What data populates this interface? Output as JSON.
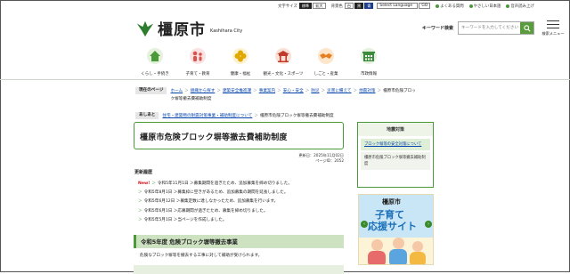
{
  "util": {
    "font_size_label": "文字サイズ",
    "font_std": "標準",
    "font_large": "拡大",
    "bg_label": "背景色",
    "bg_white": "白",
    "bg_black": "黒",
    "bg_blue": "青",
    "language": "Select Language",
    "go": "GO",
    "links": [
      "よくある質問",
      "やさしい日本語",
      "音声読み上げ"
    ]
  },
  "logo": {
    "jp": "橿原市",
    "en": "Kashihara City"
  },
  "search": {
    "label": "キーワード検索",
    "placeholder": "キーワードを入力してください"
  },
  "menu_label": "検索メニュー",
  "nav": [
    {
      "label": "くらし・手続き",
      "icon": "house-icon"
    },
    {
      "label": "子育て・教育",
      "icon": "family-icon"
    },
    {
      "label": "健康・福祉",
      "icon": "clover-icon"
    },
    {
      "label": "観光・文化・スポーツ",
      "icon": "temple-icon"
    },
    {
      "label": "しごと・産業",
      "icon": "handshake-icon"
    },
    {
      "label": "市政情報",
      "icon": "cityhall-icon"
    }
  ],
  "breadcrumb": {
    "label": "現在のページ",
    "items": [
      "ホーム",
      "組織から探す",
      "建築安全推進課",
      "事業案内",
      "安心・安全",
      "防災",
      "災害に備えて",
      "地震対策"
    ],
    "current": "橿原市危険ブロック塀等撤去費補助制度",
    "related_label": "あしあと",
    "related": "住宅・建築物の耐震対策事業・補助制度について",
    "related_current": "橿原市危険ブロック塀等撤去費補助制度"
  },
  "title": "橿原市危険ブロック塀等撤去費補助制度",
  "meta": {
    "updated": "更新日：2025年11月02日",
    "page_id": "ページID：2052"
  },
  "history": {
    "heading": "更新履歴",
    "new_label": "New!",
    "items": [
      "令和5年11月1日 ＞募集期間を過ぎたため、追加募集を締め切りました。",
      "令和5年8月1日 ＞募集枠に空きがあるため、追加募集の期間を延長しました。",
      "令和5年6月12日 ＞募集定数に達しなかったため、追加募集を行います。",
      "令和5年6月1日 ＞応募期間が過ぎたため、募集を締め切りました。",
      "令和5年5月1日 ＞当ページを作成しました。"
    ]
  },
  "section": {
    "heading": "令和5年度 危険ブロック塀等撤去事業",
    "text": "危険なブロック塀等を撤去する工事に対して補助が受けられます。"
  },
  "side": {
    "heading": "地震対策",
    "link1": "ブロック塀等の安全対策について",
    "link2": "橿原市危険ブロック塀等撤去補助制度"
  },
  "banner": {
    "t1": "橿原市",
    "t2": "子育て",
    "t3": "応援サイト"
  },
  "colors": {
    "brand": "#4a9a3a",
    "link": "#0645ad",
    "new": "#d0121b"
  }
}
